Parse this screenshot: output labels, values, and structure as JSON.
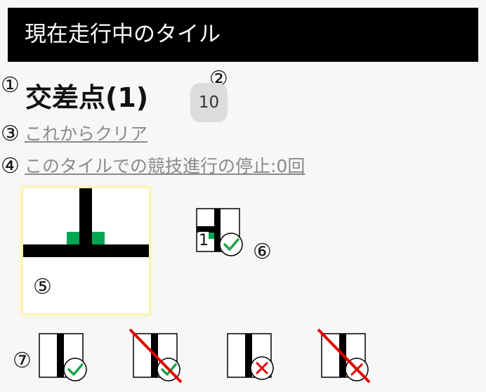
{
  "header": {
    "title": "現在走行中のタイル"
  },
  "markers": {
    "m1": "①",
    "m2": "②",
    "m3": "③",
    "m4": "④",
    "m5": "⑤",
    "m6": "⑥",
    "m7": "⑦"
  },
  "tile": {
    "name": "交差点(1)",
    "count": "10",
    "clear_link": "これからクリア",
    "stop_link": "このタイルでの競技進行の停止:0回"
  },
  "preview": {
    "label": "1"
  },
  "colors": {
    "header_bg": "#000000",
    "link": "#8a8a8a",
    "accent_green": "#00a651",
    "check": "#1aa34a",
    "cross": "#e00000",
    "highlight": "#fff2a8"
  },
  "icons": [
    "check-icon",
    "cross-icon",
    "strike-icon"
  ]
}
